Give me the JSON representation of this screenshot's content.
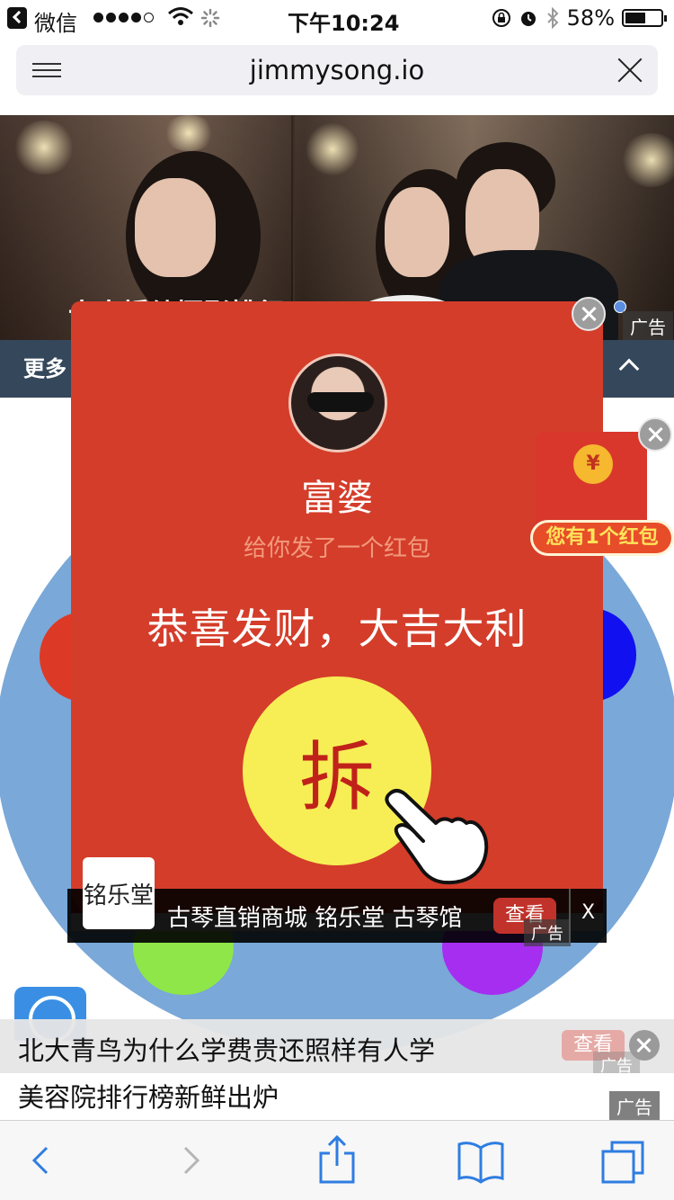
{
  "status_bar": {
    "back_app": "微信",
    "time": "下午10:24",
    "battery": "58%",
    "battery_level": 0.58
  },
  "address_bar": {
    "url": "jimmysong.io"
  },
  "banner": {
    "title": "十大婚纱摄影排行",
    "ad_tag": "广告"
  },
  "nav": {
    "more_label": "更多"
  },
  "red_packet": {
    "sender": "富婆",
    "subtitle": "给你发了一个红包",
    "blessing": "恭喜发财，大吉大利",
    "open_button": "拆"
  },
  "shop_ad": {
    "logo_text": "铭乐堂",
    "text": "古琴直销商城 铭乐堂 古琴馆",
    "view_button": "查看",
    "ad_tag": "广告",
    "close_label": "X"
  },
  "side_packet": {
    "coin": "¥",
    "badge": "您有1个红包"
  },
  "bottom_ads": {
    "row1_text": "北大青鸟为什么学费贵还照样有人学",
    "row1_view": "查看",
    "row1_tag": "广告",
    "row2_text": "美容院排行榜新鲜出炉",
    "row2_tag": "广告"
  },
  "colors": {
    "accent_blue": "#2f7de1",
    "packet_red": "#d43d2a",
    "button_yellow": "#f7ee55",
    "nav_dark": "#35475b"
  },
  "toolbar": {
    "icons": [
      "back-icon",
      "forward-icon",
      "share-icon",
      "bookmarks-icon",
      "tabs-icon"
    ]
  }
}
